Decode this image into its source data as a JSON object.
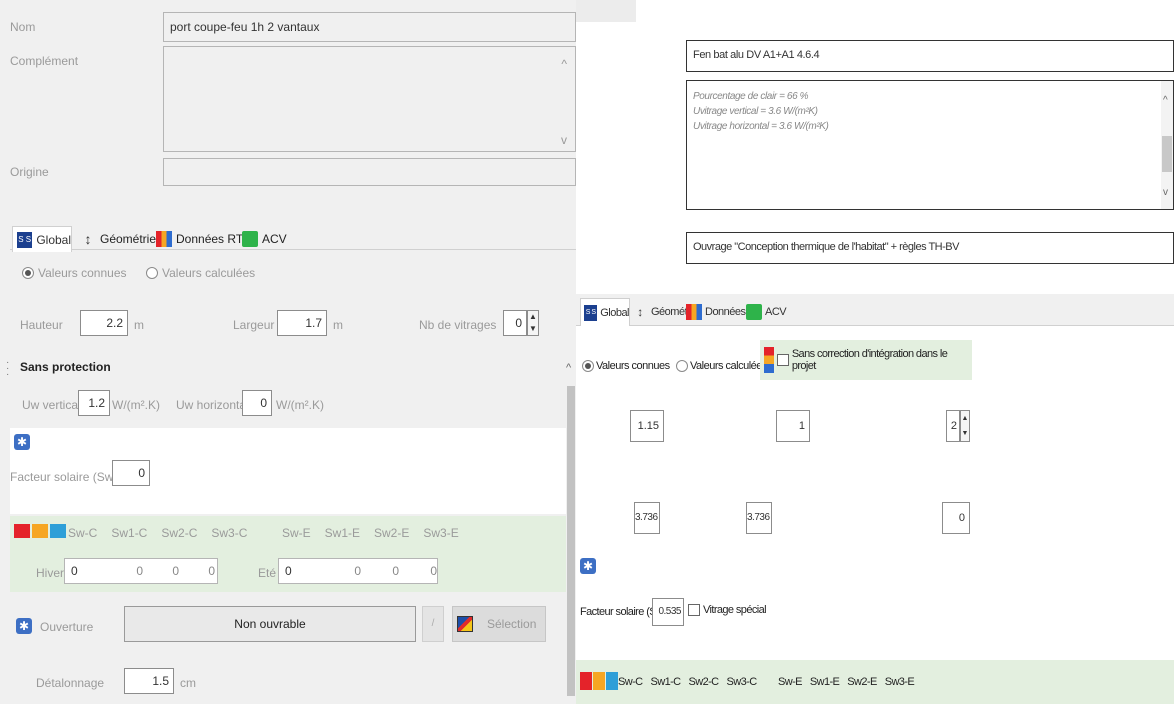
{
  "left": {
    "nom_label": "Nom",
    "nom_value": "port coupe-feu 1h 2 vantaux",
    "complement_label": "Complément",
    "origine_label": "Origine",
    "tabs": [
      "Global",
      "Géométrie",
      "Données RT",
      "ACV"
    ],
    "radio_known": "Valeurs connues",
    "radio_calc": "Valeurs calculées",
    "hauteur_label": "Hauteur",
    "hauteur_value": "2.2",
    "hauteur_unit": "m",
    "largeur_label": "Largeur",
    "largeur_value": "1.7",
    "largeur_unit": "m",
    "nbvit_label": "Nb de vitrages",
    "nbvit_value": "0",
    "sans_protection": "Sans protection",
    "uw_vertical_label": "Uw vertical",
    "uw_vertical_value": "1.2",
    "uw_unit": "W/(m².K)",
    "uw_horizontal_label": "Uw horizontal",
    "uw_horizontal_value": "0",
    "facteur_label": "Facteur solaire (Sw)",
    "facteur_value": "0",
    "sw_c": [
      "Sw-C",
      "Sw1-C",
      "Sw2-C",
      "Sw3-C"
    ],
    "sw_e": [
      "Sw-E",
      "Sw1-E",
      "Sw2-E",
      "Sw3-E"
    ],
    "hiver_label": "Hiver",
    "hiver_values": [
      "0",
      "0",
      "0",
      "0"
    ],
    "ete_label": "Eté",
    "ete_values": [
      "0",
      "0",
      "0",
      "0"
    ],
    "ouverture_label": "Ouverture",
    "ouverture_value": "Non ouvrable",
    "selection_label": "Sélection",
    "detalonnage_label": "Détalonnage",
    "detalonnage_value": "1.5",
    "detalonnage_unit": "cm"
  },
  "right": {
    "name_value": "Fen bat alu DV A1+A1 4.6.4",
    "complement_lines": [
      "Pourcentage de clair = 66 %",
      "Uvitrage vertical = 3.6 W/(m²K)",
      "Uvitrage horizontal = 3.6 W/(m²K)"
    ],
    "origine_value": "Ouvrage \"Conception thermique de l'habitat\" + règles TH-BV",
    "tabs": [
      "Global",
      "Géométrie",
      "Données RT",
      "ACV"
    ],
    "radio_known": "Valeurs connues",
    "radio_calc": "Valeurs calculées",
    "sans_correction": "Sans correction d'intégration dans le projet",
    "row1": [
      "1.15",
      "1",
      "2"
    ],
    "row2": [
      "3.736",
      "3.736",
      "0"
    ],
    "facteur_label": "Facteur solaire (Sw)",
    "facteur_value": "0.535",
    "vitrage_special": "Vitrage spécial",
    "sw_c": [
      "Sw-C",
      "Sw1-C",
      "Sw2-C",
      "Sw3-C"
    ],
    "sw_e": [
      "Sw-E",
      "Sw1-E",
      "Sw2-E",
      "Sw3-E"
    ]
  }
}
